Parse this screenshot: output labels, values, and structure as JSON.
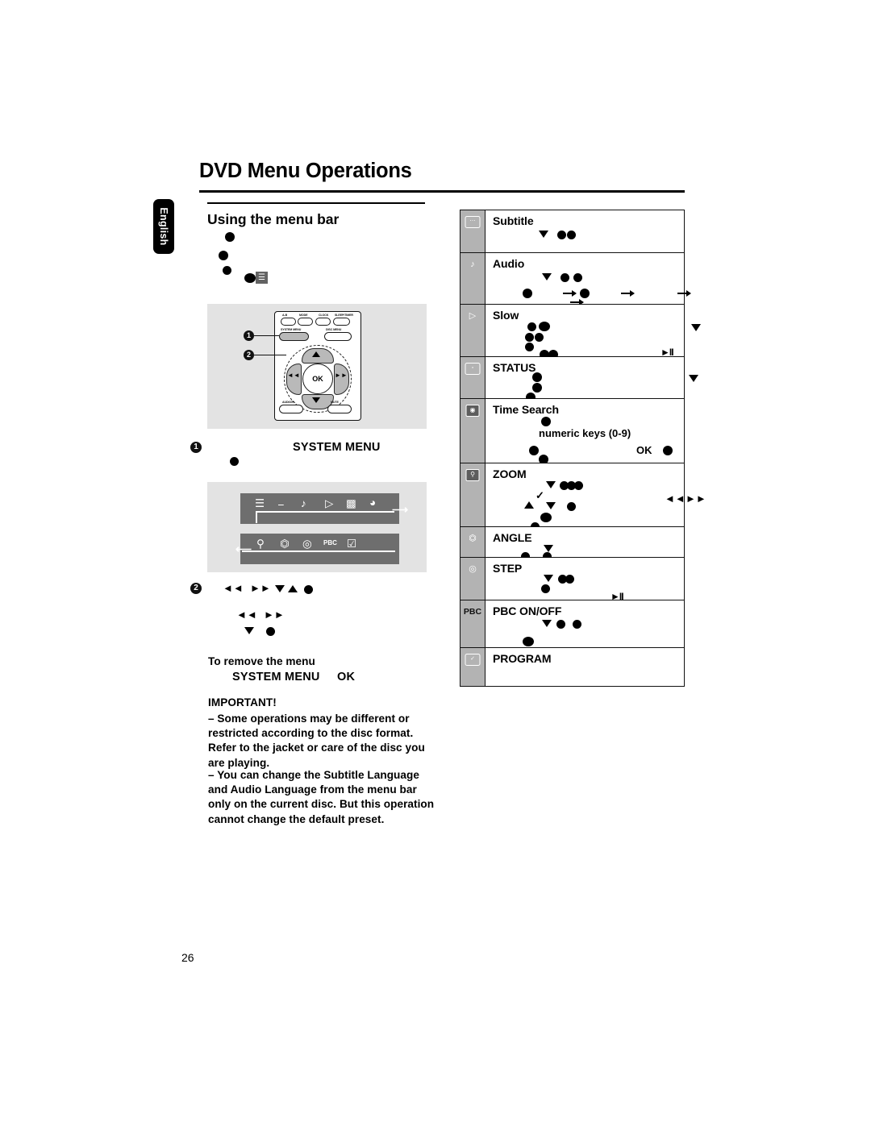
{
  "page": {
    "title": "DVD Menu Operations",
    "language_tab": "English",
    "page_number": "26",
    "section_heading": "Using the menu bar"
  },
  "remote": {
    "top_buttons": [
      "A-B",
      "MODE",
      "CLOCK",
      "SLEEP/TIMER"
    ],
    "menu_buttons": [
      "SYSTEM MENU",
      "DISC MENU"
    ],
    "bottom_buttons": [
      "AUDIO/PL",
      "MUTE"
    ],
    "ok_label": "OK",
    "callouts": [
      "1",
      "2"
    ]
  },
  "steps": {
    "step1_number": "1",
    "step1_key": "SYSTEM MENU",
    "step2_number": "2",
    "remove_heading": "To remove the menu",
    "remove_key1": "SYSTEM MENU",
    "remove_key2": "OK"
  },
  "important": {
    "heading": "IMPORTANT!",
    "bullets": [
      "–  Some operations may be different or restricted according to the disc format. Refer to the jacket or care of the disc you are playing.",
      "–  You can change the Subtitle Language and Audio Language from the menu bar only on the current disc. But this operation cannot change the default preset."
    ]
  },
  "menubar": {
    "row1_icons": [
      "setup-icon",
      "subtitle-icon",
      "audio-icon",
      "slow-icon",
      "status-icon",
      "time-search-icon"
    ],
    "row2_icons": [
      "zoom-icon",
      "angle-icon",
      "step-icon",
      "pbc-icon",
      "program-icon"
    ]
  },
  "table": {
    "rows": [
      {
        "icon": "subtitle-icon",
        "label": "Subtitle",
        "extra": ""
      },
      {
        "icon": "audio-icon",
        "label": "Audio",
        "extra": ""
      },
      {
        "icon": "slow-icon",
        "label": "Slow",
        "extra": ""
      },
      {
        "icon": "status-icon",
        "label": "STATUS",
        "extra": ""
      },
      {
        "icon": "time-search-icon",
        "label": "Time Search",
        "extra": "numeric keys (0-9)",
        "extra2": "OK"
      },
      {
        "icon": "zoom-icon",
        "label": "ZOOM",
        "extra": ""
      },
      {
        "icon": "angle-icon",
        "label": "ANGLE",
        "extra": ""
      },
      {
        "icon": "step-icon",
        "label": "STEP",
        "extra": ""
      },
      {
        "icon": "pbc-icon",
        "label": "PBC ON/OFF",
        "icon_text": "PBC",
        "extra": ""
      },
      {
        "icon": "program-icon",
        "label": "PROGRAM",
        "extra": ""
      }
    ]
  },
  "colors": {
    "panel_grey": "#e3e3e3",
    "menubar_grey": "#6e6e6e",
    "table_icon_grey": "#b3b3b3",
    "ink": "#000000"
  }
}
